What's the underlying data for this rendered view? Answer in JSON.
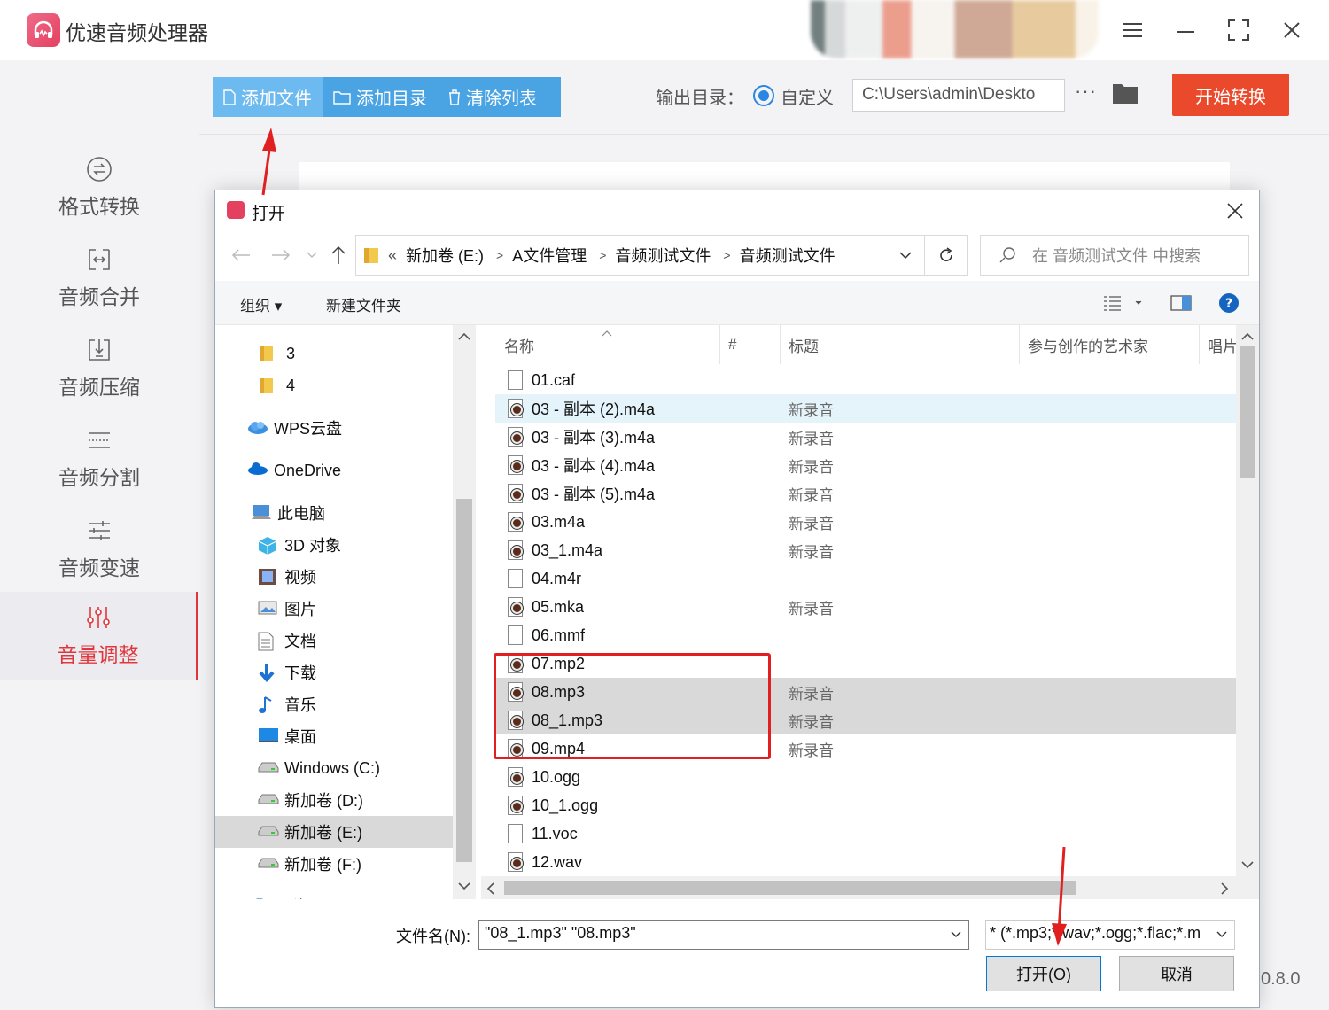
{
  "app": {
    "title": "优速音频处理器",
    "version": "0.8.0"
  },
  "sidebar": {
    "items": [
      {
        "label": "格式转换",
        "icon": "format-convert-icon",
        "active": false
      },
      {
        "label": "音频合并",
        "icon": "merge-icon",
        "active": false
      },
      {
        "label": "音频压缩",
        "icon": "compress-icon",
        "active": false
      },
      {
        "label": "音频分割",
        "icon": "split-icon",
        "active": false
      },
      {
        "label": "音频变速",
        "icon": "speed-icon",
        "active": false
      },
      {
        "label": "音量调整",
        "icon": "volume-sliders-icon",
        "active": true
      }
    ]
  },
  "toolbar": {
    "add_file": "添加文件",
    "add_dir": "添加目录",
    "clear_list": "清除列表",
    "output_label": "输出目录：",
    "custom_label": "自定义",
    "output_path": "C:\\Users\\admin\\Deskto",
    "more": "···",
    "start": "开始转换"
  },
  "dialog": {
    "title": "打开",
    "address": {
      "prefix": "«",
      "segments": [
        "新加卷 (E:)",
        "A文件管理",
        "音频测试文件",
        "音频测试文件"
      ]
    },
    "search_placeholder": "在 音频测试文件 中搜索",
    "commands": {
      "organize": "组织 ▾",
      "new_folder": "新建文件夹"
    },
    "nav_tree": [
      {
        "label": "3",
        "icon": "folder-icon"
      },
      {
        "label": "4",
        "icon": "folder-icon"
      },
      {
        "label": "WPS云盘",
        "icon": "cloud-icon"
      },
      {
        "label": "OneDrive",
        "icon": "onedrive-icon"
      },
      {
        "label": "此电脑",
        "icon": "computer-icon"
      },
      {
        "label": "3D 对象",
        "icon": "cube-icon"
      },
      {
        "label": "视频",
        "icon": "video-icon"
      },
      {
        "label": "图片",
        "icon": "picture-icon"
      },
      {
        "label": "文档",
        "icon": "document-icon"
      },
      {
        "label": "下载",
        "icon": "download-icon"
      },
      {
        "label": "音乐",
        "icon": "music-icon"
      },
      {
        "label": "桌面",
        "icon": "desktop-icon"
      },
      {
        "label": "Windows (C:)",
        "icon": "drive-icon"
      },
      {
        "label": "新加卷 (D:)",
        "icon": "drive-icon"
      },
      {
        "label": "新加卷 (E:)",
        "icon": "drive-icon",
        "selected": true
      },
      {
        "label": "新加卷 (F:)",
        "icon": "drive-icon"
      },
      {
        "label": "网络",
        "icon": "network-icon"
      }
    ],
    "columns": {
      "name": "名称",
      "num": "#",
      "title": "标题",
      "artist": "参与创作的艺术家",
      "album": "唱片"
    },
    "files": [
      {
        "name": "01.caf",
        "title": "",
        "media": false,
        "state": ""
      },
      {
        "name": "03 - 副本 (2).m4a",
        "title": "新录音",
        "media": true,
        "state": "hover"
      },
      {
        "name": "03 - 副本 (3).m4a",
        "title": "新录音",
        "media": true,
        "state": ""
      },
      {
        "name": "03 - 副本 (4).m4a",
        "title": "新录音",
        "media": true,
        "state": ""
      },
      {
        "name": "03 - 副本 (5).m4a",
        "title": "新录音",
        "media": true,
        "state": ""
      },
      {
        "name": "03.m4a",
        "title": "新录音",
        "media": true,
        "state": ""
      },
      {
        "name": "03_1.m4a",
        "title": "新录音",
        "media": true,
        "state": ""
      },
      {
        "name": "04.m4r",
        "title": "",
        "media": false,
        "state": ""
      },
      {
        "name": "05.mka",
        "title": "新录音",
        "media": true,
        "state": ""
      },
      {
        "name": "06.mmf",
        "title": "",
        "media": false,
        "state": ""
      },
      {
        "name": "07.mp2",
        "title": "",
        "media": true,
        "state": ""
      },
      {
        "name": "08.mp3",
        "title": "新录音",
        "media": true,
        "state": "sel"
      },
      {
        "name": "08_1.mp3",
        "title": "新录音",
        "media": true,
        "state": "sel"
      },
      {
        "name": "09.mp4",
        "title": "新录音",
        "media": true,
        "state": ""
      },
      {
        "name": "10.ogg",
        "title": "",
        "media": true,
        "state": ""
      },
      {
        "name": "10_1.ogg",
        "title": "",
        "media": true,
        "state": ""
      },
      {
        "name": "11.voc",
        "title": "",
        "media": false,
        "state": ""
      },
      {
        "name": "12.wav",
        "title": "",
        "media": true,
        "state": ""
      }
    ],
    "filename_label": "文件名(N):",
    "filename_value": "\"08_1.mp3\" \"08.mp3\"",
    "filetype": "* (*.mp3;*.wav;*.ogg;*.flac;*.m",
    "open_button": "打开(O)",
    "cancel_button": "取消"
  },
  "colors": {
    "accent_red": "#e0373c",
    "start_button": "#ea4a2b",
    "toolbar_blue": "#4aa3e3",
    "annotation_red": "#e02020"
  }
}
